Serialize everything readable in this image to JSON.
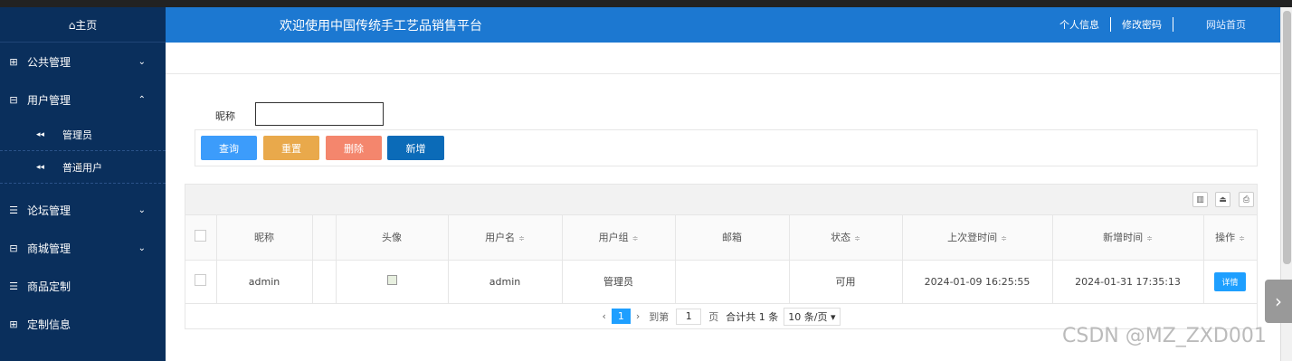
{
  "sidebar": {
    "home": "⌂主页",
    "items": [
      {
        "label": "公共管理",
        "icon": "grid-icon",
        "glyph": "⊞",
        "chev": "⌄"
      },
      {
        "label": "用户管理",
        "icon": "book-icon",
        "glyph": "⊟",
        "chev": "⌃"
      },
      {
        "label": "论坛管理",
        "icon": "list-icon",
        "glyph": "☰",
        "chev": "⌄"
      },
      {
        "label": "商城管理",
        "icon": "book-icon",
        "glyph": "⊟",
        "chev": "⌄"
      },
      {
        "label": "商品定制",
        "icon": "list-icon",
        "glyph": "☰",
        "chev": ""
      },
      {
        "label": "定制信息",
        "icon": "grid-icon",
        "glyph": "⊞",
        "chev": ""
      }
    ],
    "subitems": [
      {
        "label": "管理员",
        "glyph": "◂◂"
      },
      {
        "label": "普通用户",
        "glyph": "◂◂"
      }
    ]
  },
  "header": {
    "title": "欢迎使用中国传统手工艺品销售平台",
    "links": [
      "个人信息",
      "修改密码",
      "网站首页"
    ]
  },
  "search": {
    "label": "昵称",
    "value": ""
  },
  "buttons": {
    "query": "查询",
    "reset": "重置",
    "delete": "删除",
    "add": "新增"
  },
  "colors": {
    "query": "#3c9cfb",
    "reset": "#e9a94b",
    "delete": "#f4866d",
    "add": "#0b6bb8"
  },
  "table": {
    "headers": [
      "昵称",
      "头像",
      "用户名",
      "用户组",
      "邮箱",
      "状态",
      "上次登时间",
      "新增时间",
      "操作"
    ],
    "sort_glyph": "≑",
    "rows": [
      {
        "nickname": "admin",
        "username": "admin",
        "group": "管理员",
        "email": "",
        "status": "可用",
        "last_login": "2024-01-09 16:25:55",
        "created": "2024-01-31 17:35:13",
        "action": "详情"
      }
    ]
  },
  "pager": {
    "prev": "‹",
    "current": "1",
    "next": "›",
    "goto_label": "到第",
    "goto_value": "1",
    "page_unit": "页",
    "total": "合计共 1 条",
    "per_page": "10 条/页 ▾"
  },
  "watermark": "CSDN @MZ_ZXD001",
  "scroll_arrow": "›"
}
